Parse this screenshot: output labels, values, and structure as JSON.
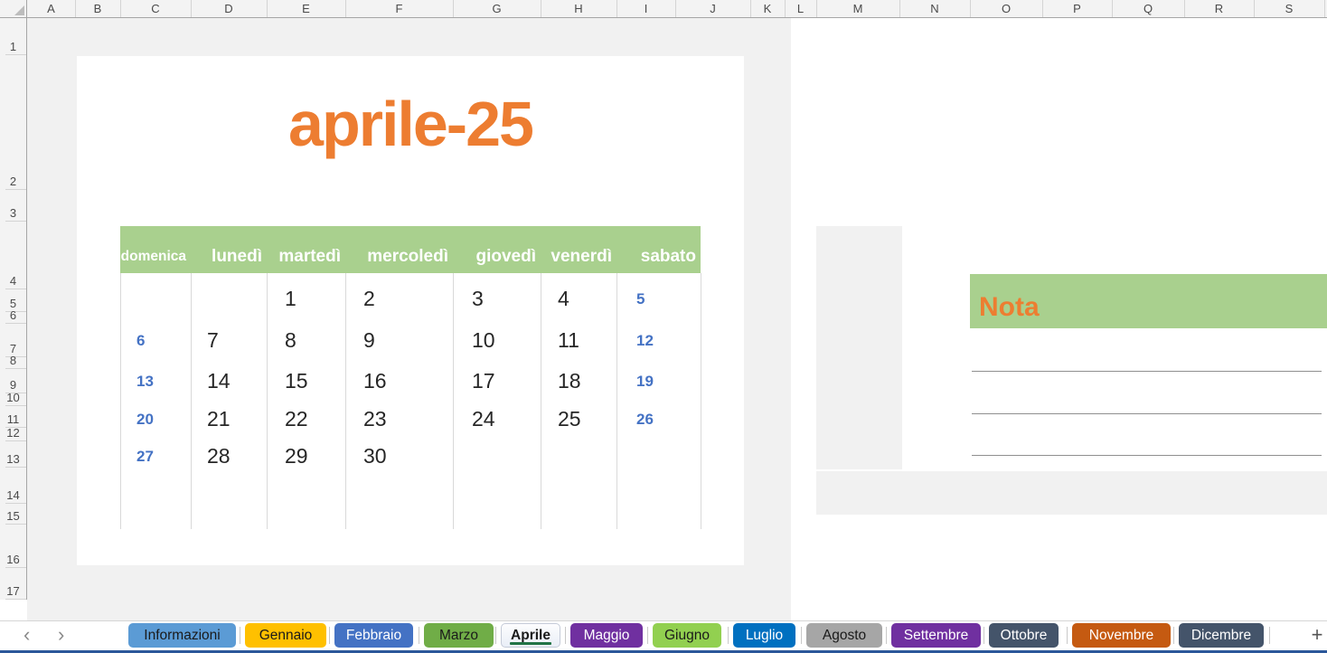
{
  "grid": {
    "column_headers": [
      "A",
      "B",
      "C",
      "D",
      "E",
      "F",
      "G",
      "H",
      "I",
      "J",
      "K",
      "L",
      "M",
      "N",
      "O",
      "P",
      "Q",
      "R",
      "S"
    ],
    "row_headers": [
      "1",
      "2",
      "3",
      "4",
      "5",
      "6",
      "7",
      "8",
      "9",
      "10",
      "11",
      "12",
      "13",
      "14",
      "15",
      "16",
      "17"
    ]
  },
  "calendar": {
    "title": "aprile-25",
    "day_headers": [
      "domenica",
      "lunedì",
      "martedì",
      "mercoledì",
      "giovedì",
      "venerdì",
      "sabato"
    ],
    "weeks": [
      [
        "",
        "",
        "1",
        "2",
        "3",
        "4",
        "5"
      ],
      [
        "6",
        "7",
        "8",
        "9",
        "10",
        "11",
        "12"
      ],
      [
        "13",
        "14",
        "15",
        "16",
        "17",
        "18",
        "19"
      ],
      [
        "20",
        "21",
        "22",
        "23",
        "24",
        "25",
        "26"
      ],
      [
        "27",
        "28",
        "29",
        "30",
        "",
        "",
        ""
      ]
    ],
    "weekend_columns": [
      0,
      6
    ]
  },
  "notes": {
    "title": "Nota",
    "ruled_line_count": 3
  },
  "sheet_tabs": {
    "nav_prev_icon": "‹",
    "nav_next_icon": "›",
    "add_sheet_label": "+",
    "active": "Aprile",
    "tabs": [
      {
        "label": "Informazioni",
        "bg": "#5B9BD5",
        "fg": "#1a1a1a",
        "active": false
      },
      {
        "label": "Gennaio",
        "bg": "#FFC000",
        "fg": "#1a1a1a",
        "active": false
      },
      {
        "label": "Febbraio",
        "bg": "#4472C4",
        "fg": "#FFFFFF",
        "active": false
      },
      {
        "label": "Marzo",
        "bg": "#70AD47",
        "fg": "#1a1a1a",
        "active": false
      },
      {
        "label": "Aprile",
        "bg": "#EDF1F9",
        "fg": "#1a1a1a",
        "active": true
      },
      {
        "label": "Maggio",
        "bg": "#7030A0",
        "fg": "#FFFFFF",
        "active": false
      },
      {
        "label": "Giugno",
        "bg": "#92D050",
        "fg": "#1a1a1a",
        "active": false
      },
      {
        "label": "Luglio",
        "bg": "#0070C0",
        "fg": "#FFFFFF",
        "active": false
      },
      {
        "label": "Agosto",
        "bg": "#A6A6A6",
        "fg": "#1a1a1a",
        "active": false
      },
      {
        "label": "Settembre",
        "bg": "#7030A0",
        "fg": "#FFFFFF",
        "active": false
      },
      {
        "label": "Ottobre",
        "bg": "#44546A",
        "fg": "#FFFFFF",
        "active": false
      },
      {
        "label": "Novembre",
        "bg": "#C55A11",
        "fg": "#FFFFFF",
        "active": false
      },
      {
        "label": "Dicembre",
        "bg": "#44546A",
        "fg": "#FFFFFF",
        "active": false
      }
    ]
  },
  "colors": {
    "accent_orange": "#ED7D31",
    "band_green": "#A9D08E",
    "weekend_blue": "#4472C4",
    "weekday_text": "#262626",
    "active_tab_underline": "#217346",
    "window_edge_blue": "#2B579A"
  }
}
